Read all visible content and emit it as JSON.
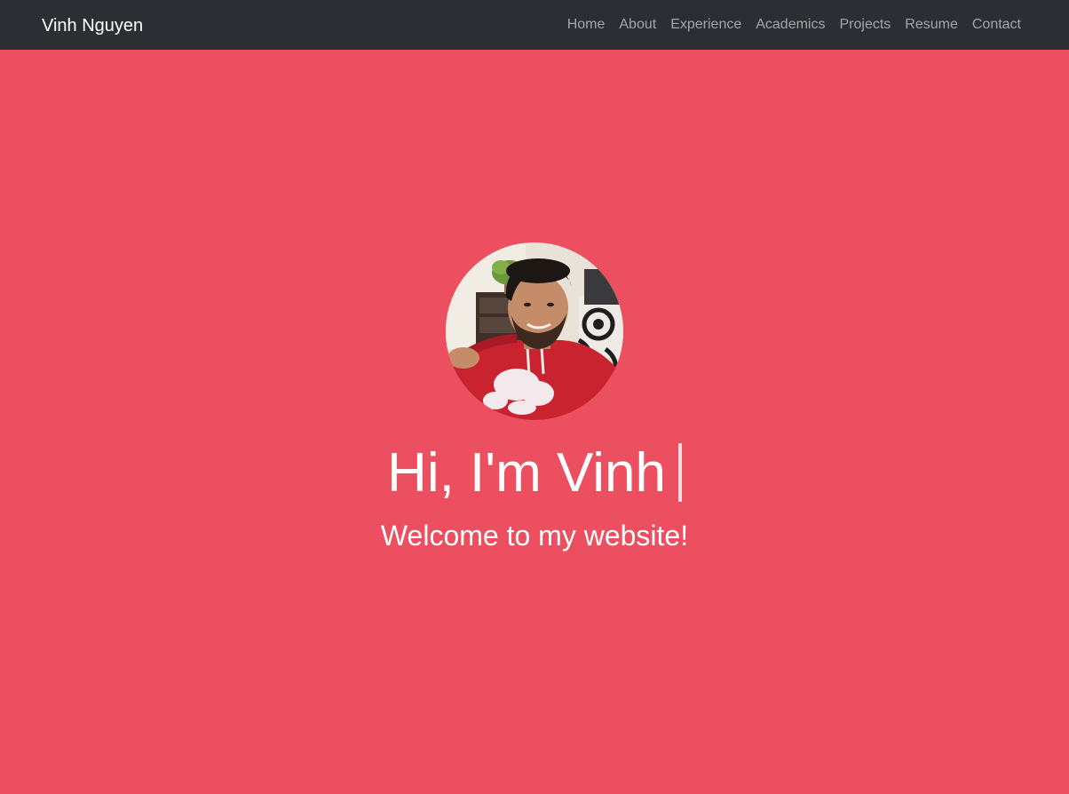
{
  "navbar": {
    "brand": "Vinh Nguyen",
    "links": [
      "Home",
      "About",
      "Experience",
      "Academics",
      "Projects",
      "Resume",
      "Contact"
    ]
  },
  "hero": {
    "greeting": "Hi, I'm Vinh",
    "subtitle": "Welcome to my website!",
    "avatar_alt": "Profile photo of Vinh"
  },
  "colors": {
    "navbar_bg": "#2c2e33",
    "hero_bg": "#ec4f5f",
    "nav_link": "#a4a6aa",
    "text": "#ffffff"
  }
}
